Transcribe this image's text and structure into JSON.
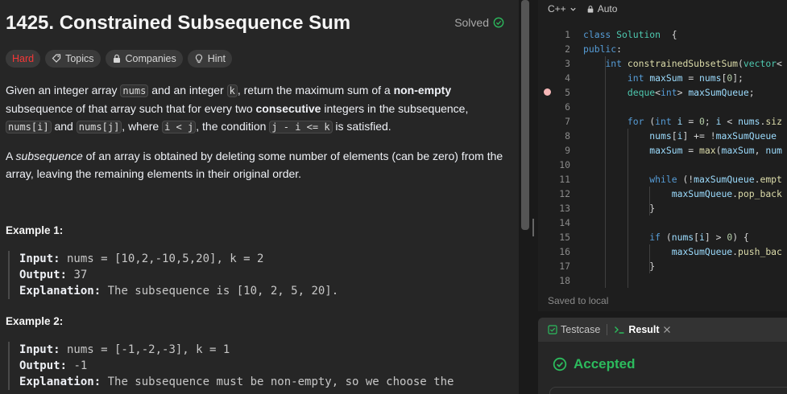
{
  "problem": {
    "title": "1425. Constrained Subsequence Sum",
    "status": "Solved",
    "tags": {
      "difficulty": "Hard",
      "topics": "Topics",
      "companies": "Companies",
      "hint": "Hint"
    }
  },
  "description": {
    "p1": [
      {
        "t": "Given an integer array "
      },
      {
        "c": "nums"
      },
      {
        "t": " and an integer "
      },
      {
        "c": "k"
      },
      {
        "t": ", return the maximum sum of a "
      },
      {
        "b": "non-empty"
      },
      {
        "t": " subsequence of that array such that for every two "
      },
      {
        "b": "consecutive"
      },
      {
        "t": " integers in the subsequence, "
      },
      {
        "c": "nums[i]"
      },
      {
        "t": " and "
      },
      {
        "c": "nums[j]"
      },
      {
        "t": ", where "
      },
      {
        "c": "i < j"
      },
      {
        "t": ", the condition "
      },
      {
        "c": "j - i <= k"
      },
      {
        "t": " is satisfied."
      }
    ],
    "p2": [
      {
        "t": "A "
      },
      {
        "i": "subsequence"
      },
      {
        "t": " of an array is obtained by deleting some number of elements (can be zero) from the array, leaving the remaining elements in their original order."
      }
    ]
  },
  "examples": [
    {
      "title": "Example 1:",
      "input_label": "Input:",
      "input": " nums = [10,2,-10,5,20], k = 2",
      "output_label": "Output:",
      "output": " 37",
      "explanation_label": "Explanation:",
      "explanation": " The subsequence is [10, 2, 5, 20]."
    },
    {
      "title": "Example 2:",
      "input_label": "Input:",
      "input": " nums = [-1,-2,-3], k = 1",
      "output_label": "Output:",
      "output": " -1",
      "explanation_label": "Explanation:",
      "explanation": " The subsequence must be non-empty, so we choose the"
    }
  ],
  "editor": {
    "language": "C++",
    "mode": "Auto",
    "saved_status": "Saved to local",
    "lines": [
      [
        [
          "kw",
          "class "
        ],
        [
          "ty",
          "Solution"
        ],
        [
          "",
          "  {"
        ]
      ],
      [
        [
          "kw",
          "public"
        ],
        [
          "",
          ":"
        ]
      ],
      [
        [
          "",
          "    "
        ],
        [
          "kw",
          "int "
        ],
        [
          "fn",
          "constrainedSubsetSum"
        ],
        [
          "",
          "("
        ],
        [
          "ty",
          "vector"
        ],
        [
          "",
          "<"
        ]
      ],
      [
        [
          "",
          "        "
        ],
        [
          "kw",
          "int "
        ],
        [
          "vr",
          "maxSum"
        ],
        [
          "",
          " = "
        ],
        [
          "vr",
          "nums"
        ],
        [
          "",
          "["
        ],
        [
          "nm",
          "0"
        ],
        [
          "",
          "];"
        ]
      ],
      [
        [
          "",
          "        "
        ],
        [
          "ty",
          "deque"
        ],
        [
          "",
          "<"
        ],
        [
          "kw",
          "int"
        ],
        [
          "",
          "> "
        ],
        [
          "vr",
          "maxSumQueue"
        ],
        [
          "",
          ";"
        ]
      ],
      [
        [
          "",
          ""
        ]
      ],
      [
        [
          "",
          "        "
        ],
        [
          "kw",
          "for "
        ],
        [
          "",
          "("
        ],
        [
          "kw",
          "int "
        ],
        [
          "vr",
          "i"
        ],
        [
          "",
          " = "
        ],
        [
          "nm",
          "0"
        ],
        [
          "",
          "; "
        ],
        [
          "vr",
          "i"
        ],
        [
          "",
          " < "
        ],
        [
          "vr",
          "nums"
        ],
        [
          "",
          "."
        ],
        [
          "fn",
          "siz"
        ]
      ],
      [
        [
          "",
          "            "
        ],
        [
          "vr",
          "nums"
        ],
        [
          "",
          "["
        ],
        [
          "vr",
          "i"
        ],
        [
          "",
          "] += !"
        ],
        [
          "vr",
          "maxSumQueue"
        ]
      ],
      [
        [
          "",
          "            "
        ],
        [
          "vr",
          "maxSum"
        ],
        [
          "",
          " = "
        ],
        [
          "fn",
          "max"
        ],
        [
          "",
          "("
        ],
        [
          "vr",
          "maxSum"
        ],
        [
          "",
          ", "
        ],
        [
          "vr",
          "num"
        ]
      ],
      [
        [
          "",
          ""
        ]
      ],
      [
        [
          "",
          "            "
        ],
        [
          "kw",
          "while "
        ],
        [
          "",
          "(!"
        ],
        [
          "vr",
          "maxSumQueue"
        ],
        [
          "",
          "."
        ],
        [
          "fn",
          "empt"
        ]
      ],
      [
        [
          "",
          "                "
        ],
        [
          "vr",
          "maxSumQueue"
        ],
        [
          "",
          "."
        ],
        [
          "fn",
          "pop_back"
        ]
      ],
      [
        [
          "",
          "            }"
        ]
      ],
      [
        [
          "",
          ""
        ]
      ],
      [
        [
          "",
          "            "
        ],
        [
          "kw",
          "if "
        ],
        [
          "",
          "("
        ],
        [
          "vr",
          "nums"
        ],
        [
          "",
          "["
        ],
        [
          "vr",
          "i"
        ],
        [
          "",
          "] > "
        ],
        [
          "nm",
          "0"
        ],
        [
          "",
          ") {"
        ]
      ],
      [
        [
          "",
          "                "
        ],
        [
          "vr",
          "maxSumQueue"
        ],
        [
          "",
          "."
        ],
        [
          "fn",
          "push_bac"
        ]
      ],
      [
        [
          "",
          "            }"
        ]
      ],
      [
        [
          "",
          ""
        ]
      ]
    ]
  },
  "result": {
    "testcase_tab": "Testcase",
    "result_tab": "Result",
    "status": "Accepted"
  },
  "colors": {
    "hard": "#f63737",
    "accepted": "#2cbb5d",
    "keyword": "#569cd6",
    "type": "#4ec9b0",
    "function": "#dcdcaa"
  }
}
